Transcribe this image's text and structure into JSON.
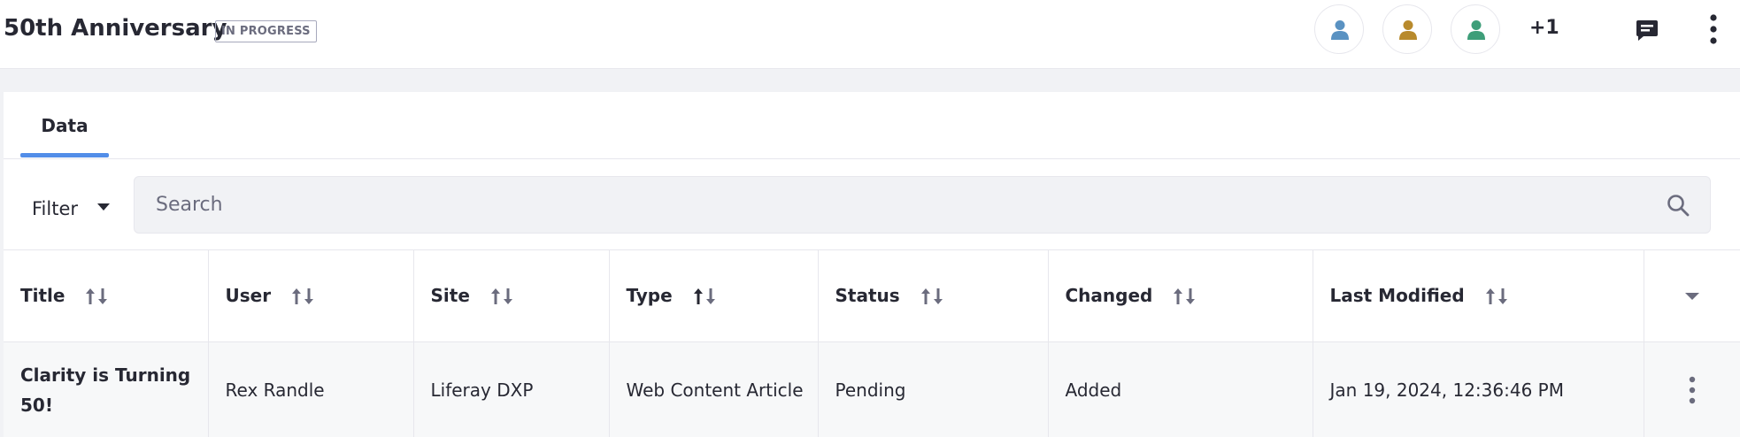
{
  "header": {
    "title": "50th Anniversary",
    "status_badge": "IN PROGRESS",
    "avatars": [
      {
        "icon": "user-icon",
        "color": "#5a92c2"
      },
      {
        "icon": "user-icon",
        "color": "#b88a2c"
      },
      {
        "icon": "user-icon",
        "color": "#3e9e79"
      }
    ],
    "avatars_more": "+1",
    "comments_icon": "comment-icon",
    "options_icon": "kebab-vertical-icon"
  },
  "tabs": [
    {
      "label": "Data",
      "active": true
    }
  ],
  "toolbar": {
    "filter_label": "Filter",
    "search_placeholder": "Search"
  },
  "table": {
    "columns": [
      {
        "label": "Title",
        "sort": "none"
      },
      {
        "label": "User",
        "sort": "none"
      },
      {
        "label": "Site",
        "sort": "none"
      },
      {
        "label": "Type",
        "sort": "ascending"
      },
      {
        "label": "Status",
        "sort": "none"
      },
      {
        "label": "Changed",
        "sort": "none"
      },
      {
        "label": "Last Modified",
        "sort": "none"
      }
    ],
    "rows": [
      {
        "title": "Clarity is Turning 50!",
        "user": "Rex Randle",
        "site": "Liferay DXP",
        "type": "Web Content Article",
        "status": "Pending",
        "changed": "Added",
        "last_modified": "Jan 19, 2024, 12:36:46 PM"
      }
    ]
  },
  "colors": {
    "accent": "#528de8",
    "background": "#f1f2f5"
  }
}
